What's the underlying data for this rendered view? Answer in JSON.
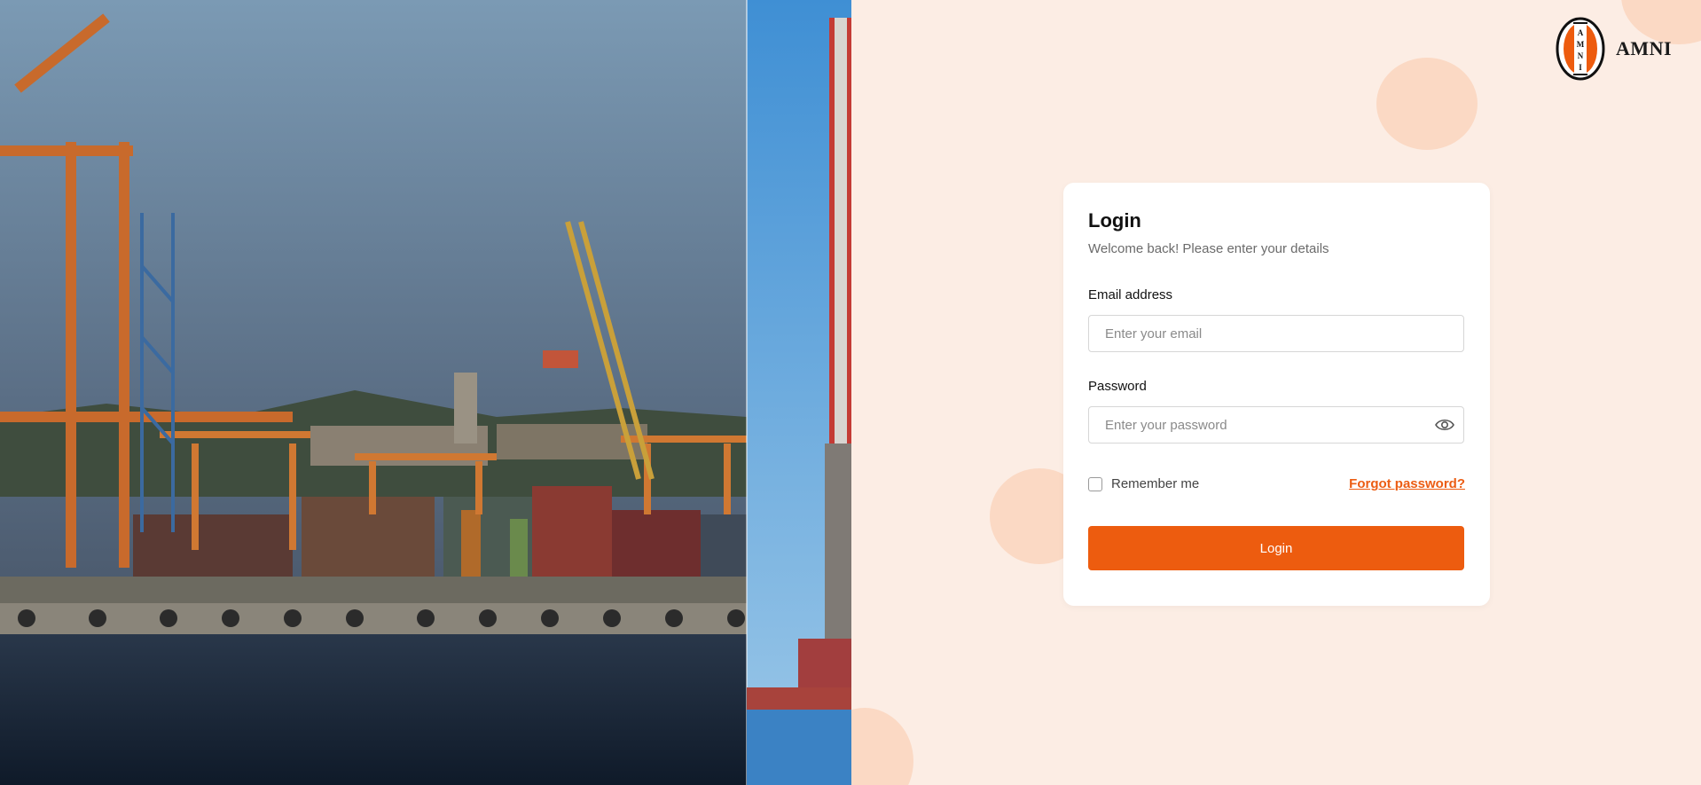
{
  "brand": {
    "name": "AMNI",
    "logo_letters": [
      "A",
      "M",
      "N",
      "I"
    ]
  },
  "login": {
    "title": "Login",
    "subtitle": "Welcome back! Please enter your details",
    "email_label": "Email address",
    "email_placeholder": "Enter your email",
    "email_value": "",
    "password_label": "Password",
    "password_placeholder": "Enter your password",
    "password_value": "",
    "remember_label": "Remember me",
    "remember_checked": false,
    "forgot_label": "Forgot password?",
    "submit_label": "Login"
  },
  "icons": {
    "show_password": "eye-icon"
  },
  "colors": {
    "accent": "#ed5c0f",
    "background": "#fcede4",
    "blob": "#fbd9c4"
  }
}
